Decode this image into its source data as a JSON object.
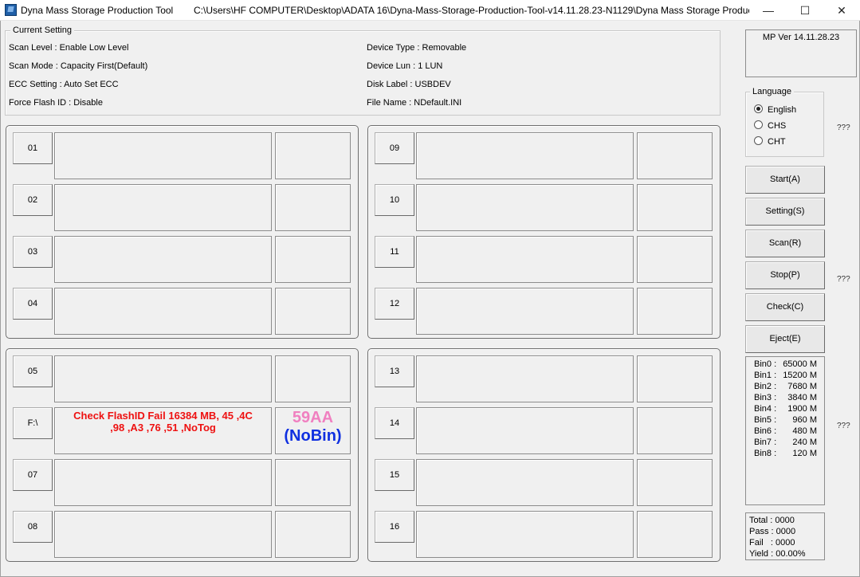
{
  "window": {
    "app_name": "Dyna Mass Storage Production Tool",
    "path": "C:\\Users\\HF COMPUTER\\Desktop\\ADATA 16\\Dyna-Mass-Storage-Production-Tool-v14.11.28.23-N1129\\Dyna Mass Storage Produc...",
    "minimize": "—",
    "maximize": "☐",
    "close": "✕"
  },
  "current_setting": {
    "title": "Current Setting",
    "scan_level": "Scan Level : Enable Low Level",
    "scan_mode": "Scan Mode : Capacity First(Default)",
    "ecc_setting": "ECC Setting : Auto Set ECC",
    "force_flash_id": "Force Flash ID : Disable",
    "device_type": "Device Type : Removable",
    "device_lun": "Device Lun : 1 LUN",
    "disk_label": "Disk Label : USBDEV",
    "file_name": "File Name : NDefault.INI"
  },
  "slots": {
    "s01": "01",
    "s02": "02",
    "s03": "03",
    "s04": "04",
    "s05": "05",
    "s06": "F:\\",
    "s07": "07",
    "s08": "08",
    "s09": "09",
    "s10": "10",
    "s11": "11",
    "s12": "12",
    "s13": "13",
    "s14": "14",
    "s15": "15",
    "s16": "16",
    "s06_status_line1": "Check FlashID Fail 16384 MB, 45 ,4C",
    "s06_status_line2": ",98 ,A3 ,76 ,51 ,NoTog",
    "s06_chip": "59AA",
    "s06_bin": "(NoBin)"
  },
  "panel": {
    "version": "MP Ver 14.11.28.23",
    "language_title": "Language",
    "lang_english": "English",
    "lang_chs": "CHS",
    "lang_cht": "CHT",
    "qmark": "???",
    "start": "Start(A)",
    "setting": "Setting(S)",
    "scan": "Scan(R)",
    "stop": "Stop(P)",
    "check": "Check(C)",
    "eject": "Eject(E)"
  },
  "bins": {
    "b0_label": "Bin0 :",
    "b0_val": "65000 M",
    "b1_label": "Bin1 :",
    "b1_val": "15200 M",
    "b2_label": "Bin2 :",
    "b2_val": "7680 M",
    "b3_label": "Bin3 :",
    "b3_val": "3840 M",
    "b4_label": "Bin4 :",
    "b4_val": "1900 M",
    "b5_label": "Bin5 :",
    "b5_val": "960 M",
    "b6_label": "Bin6 :",
    "b6_val": "480 M",
    "b7_label": "Bin7 :",
    "b7_val": "240 M",
    "b8_label": "Bin8 :",
    "b8_val": "120 M"
  },
  "stats": {
    "total": "Total : 0000",
    "pass": "Pass : 0000",
    "fail": "Fail   : 0000",
    "yield": "Yield : 00.00%"
  }
}
